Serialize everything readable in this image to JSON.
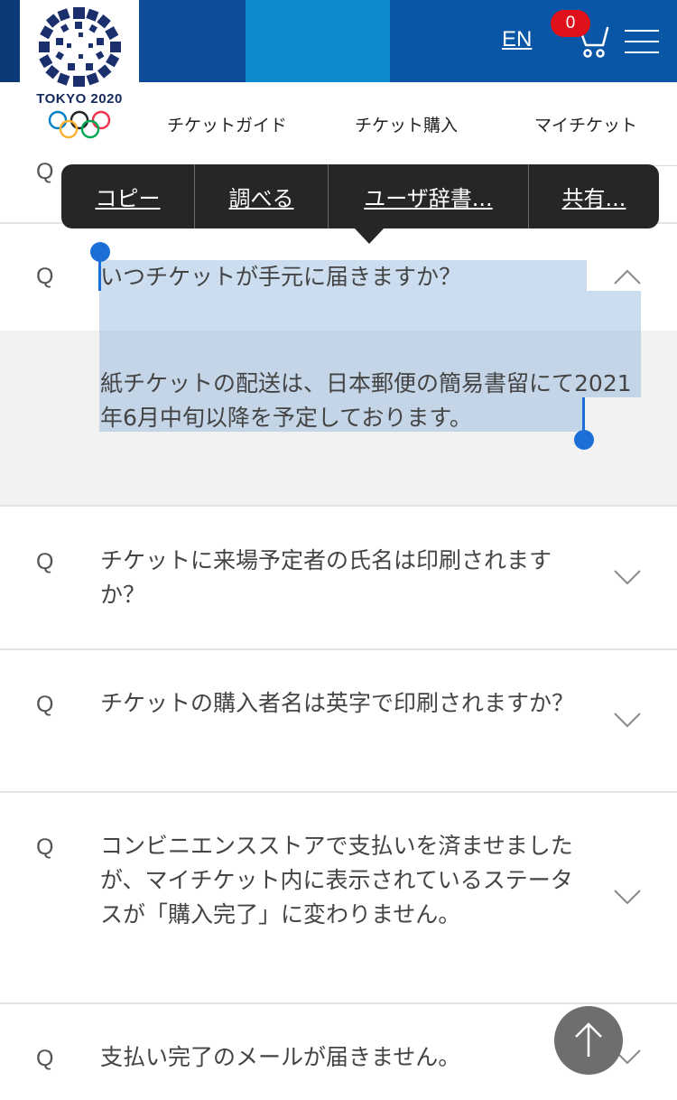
{
  "header": {
    "logo_text": "TOKYO 2020",
    "lang_link": "EN",
    "cart_count": "0",
    "colors": {
      "dark_blue": "#0c3a79",
      "mid_blue": "#0e8bcf",
      "brand_blue": "#0a56a6",
      "badge_red": "#e0111b"
    }
  },
  "nav": {
    "items": [
      {
        "label": "チケットガイド"
      },
      {
        "label": "チケット購入"
      },
      {
        "label": "マイチケット"
      }
    ]
  },
  "context_menu": {
    "items": [
      {
        "label": "コピー"
      },
      {
        "label": "調べる"
      },
      {
        "label": "ユーザ辞書..."
      },
      {
        "label": "共有..."
      }
    ]
  },
  "faq": {
    "q_marker": "Q",
    "items": [
      {
        "question": "いつチケットが手元に届きますか？",
        "expanded": true,
        "answer": "紙チケットの配送は、日本郵便の簡易書留にて2021年6月中旬以降を予定しております。"
      },
      {
        "question": "チケットに来場予定者の氏名は印刷されますか？",
        "expanded": false
      },
      {
        "question": "チケットの購入者名は英字で印刷されますか？",
        "expanded": false
      },
      {
        "question": "コンビニエンスストアで支払いを済ませましたが、マイチケット内に表示されているステータスが「購入完了」に変わりません。",
        "expanded": false
      },
      {
        "question": "支払い完了のメールが届きません。",
        "expanded": false
      }
    ]
  }
}
